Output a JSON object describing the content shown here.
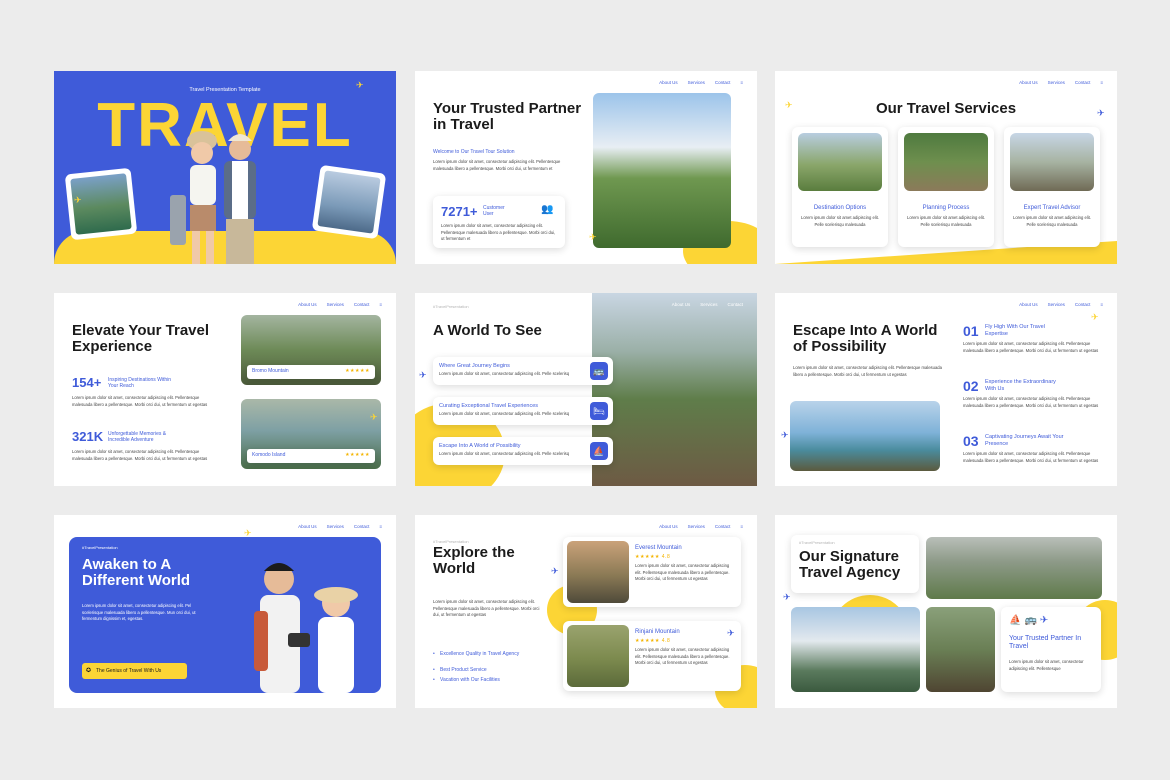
{
  "brand": {
    "blue": "#3f5bd9",
    "yellow": "#fcd535"
  },
  "nav": {
    "about": "About Us",
    "services": "Services",
    "contact": "Contact",
    "menu_icon": "≡"
  },
  "tag": "#TravelPresentation",
  "lorem2": "Lorem ipsum dolor sit amet, consectetur adipiscing elit. Pellentesque malesuada libero a pellentesque. Morbi orci dui, ut fermentum et",
  "lorem_short": "Lorem ipsum dolor sit amet, consectetur adipiscing elit. Pellentesque malesuada libero a pellentesque. Morbi orci dui, ut fermentum ut egestas",
  "slide1": {
    "subtitle": "Travel Presentation Template",
    "title": "TRAVEL"
  },
  "slide2": {
    "title": "Your Trusted Partner in Travel",
    "subtitle": "Welcome to Our Travel Tour Solution",
    "stat": "7271+",
    "stat_label": "Customer User"
  },
  "slide3": {
    "title": "Our Travel Services",
    "services": [
      {
        "label": "Destination Options"
      },
      {
        "label": "Planning Process"
      },
      {
        "label": "Expert Travel Advisor"
      }
    ],
    "svc_text": "Lorem ipsum dolor sit amet adipiscing elit. Pelle scelerisqu malesuada"
  },
  "slide4": {
    "title": "Elevate Your Travel Experience",
    "stat1": "154+",
    "stat1_label": "Inspiring Destinations Within Your Reach",
    "stat2": "321K",
    "stat2_label": "Unforgettable Memories & Incredible Adventure",
    "place1": "Bromo Mountain",
    "place2": "Komodo Island",
    "stars": "★★★★★"
  },
  "slide5": {
    "title": "A World To See",
    "items": [
      {
        "label": "Where Great Journey Begins"
      },
      {
        "label": "Curating Exceptional Travel Experiences"
      },
      {
        "label": "Escape Into A World of Possibility"
      }
    ],
    "item_text": "Lorem ipsum dolor sit amet, consectetur adipiscing elit. Pelle scelerisq"
  },
  "slide6": {
    "title": "Escape Into A World of Possibility",
    "points": [
      {
        "num": "01",
        "label": "Fly High With Our Travel Expertise"
      },
      {
        "num": "02",
        "label": "Experience the Extraordinary With Us"
      },
      {
        "num": "03",
        "label": "Captivating Journeys Await Your Presence"
      }
    ]
  },
  "slide7": {
    "tag": "#TravelPresentation",
    "title": "Awaken to A Different World",
    "text": "Lorem ipsum dolor sit amet, consectetur adipiscing elit. Pel scelerisque malesuada libero a pellentesque. Mun orci dui, ut fermentum dignissim et, egestas.",
    "button": "The Genius of Travel With Us"
  },
  "slide8": {
    "title": "Explore the World",
    "place1": "Everest Mountain",
    "place2": "Rinjani Mountain",
    "rating": "★★★★★ 4.8",
    "bullets": [
      "Excellence Quality in Travel Agency",
      "Best Product Service",
      "Vacation with Our Facilities"
    ]
  },
  "slide9": {
    "title": "Our Signature Travel Agency",
    "subtitle": "Your Trusted Partner In Travel",
    "text": "Lorem ipsum dolor sit amet, consectetur adipiscing elit. Pellentesque"
  }
}
